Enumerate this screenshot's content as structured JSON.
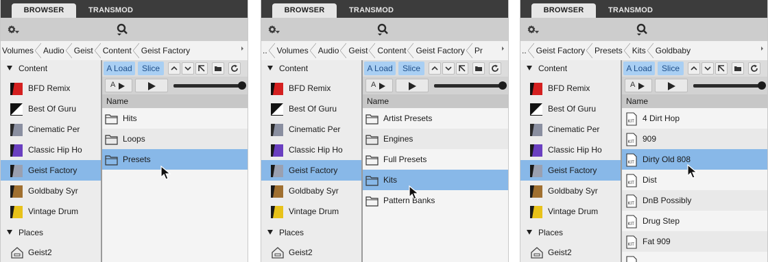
{
  "tabs": [
    "BROWSER",
    "TRANSMOD"
  ],
  "panels": [
    {
      "breadcrumb": [
        "Volumes",
        "Audio",
        "Geist",
        "Content",
        "Geist Factory"
      ],
      "breadcrumb_lead": "",
      "list": [
        {
          "label": "Hits",
          "icon": "folder-icon"
        },
        {
          "label": "Loops",
          "icon": "folder-icon"
        },
        {
          "label": "Presets",
          "icon": "folder-icon",
          "selected": true
        }
      ]
    },
    {
      "breadcrumb": [
        "Volumes",
        "Audio",
        "Geist",
        "Content",
        "Geist Factory",
        "Pr"
      ],
      "breadcrumb_lead": "..",
      "list": [
        {
          "label": "Artist Presets",
          "icon": "folder-icon"
        },
        {
          "label": "Engines",
          "icon": "folder-icon"
        },
        {
          "label": "Full Presets",
          "icon": "folder-icon"
        },
        {
          "label": "Kits",
          "icon": "folder-icon",
          "selected": true
        },
        {
          "label": "Pattern Banks",
          "icon": "folder-icon"
        }
      ]
    },
    {
      "breadcrumb": [
        "Geist Factory",
        "Presets",
        "Kits",
        "Goldbaby"
      ],
      "breadcrumb_lead": "..",
      "list": [
        {
          "label": "4 Dirt Hop",
          "icon": "kit-file-icon"
        },
        {
          "label": "909",
          "icon": "kit-file-icon"
        },
        {
          "label": "Dirty Old 808",
          "icon": "kit-file-icon",
          "selected": true
        },
        {
          "label": "Dist",
          "icon": "kit-file-icon"
        },
        {
          "label": "DnB Possibly",
          "icon": "kit-file-icon"
        },
        {
          "label": "Drug Step",
          "icon": "kit-file-icon"
        },
        {
          "label": "Fat 909",
          "icon": "kit-file-icon"
        }
      ]
    }
  ],
  "tree": {
    "content_header": "Content",
    "items": [
      {
        "label": "BFD Remix",
        "colors": [
          "#111111",
          "#d42020"
        ]
      },
      {
        "label": "Best Of Guru",
        "colors": [
          "#111111",
          "#ffffff"
        ]
      },
      {
        "label": "Cinematic Per",
        "colors": [
          "#2a2a2a",
          "#8a8fa0"
        ]
      },
      {
        "label": "Classic Hip Ho",
        "colors": [
          "#1a1a1a",
          "#6a3fc0"
        ]
      },
      {
        "label": "Geist Factory",
        "colors": [
          "#1a1a1a",
          "#9aa0b0"
        ],
        "selected": true
      },
      {
        "label": "Goldbaby Syr",
        "colors": [
          "#1a1a1a",
          "#a07030"
        ]
      },
      {
        "label": "Vintage Drum",
        "colors": [
          "#1a1a1a",
          "#e8c21a"
        ]
      }
    ],
    "places_header": "Places",
    "places": [
      {
        "label": "Geist2",
        "icon": "home-drive-icon"
      }
    ]
  },
  "controls": {
    "load_label": "A Load",
    "slice_label": "Slice",
    "preview_a": "A",
    "column_header": "Name",
    "icon_buttons": [
      "chevron-up-icon",
      "chevron-down-icon",
      "go-up-icon",
      "folder-open-icon",
      "refresh-icon"
    ]
  },
  "colors": {
    "selection": "#88b8e8",
    "accent_button": "#a9cff3",
    "tab_bar": "#3c3c3c"
  },
  "volume_level": 1.0
}
